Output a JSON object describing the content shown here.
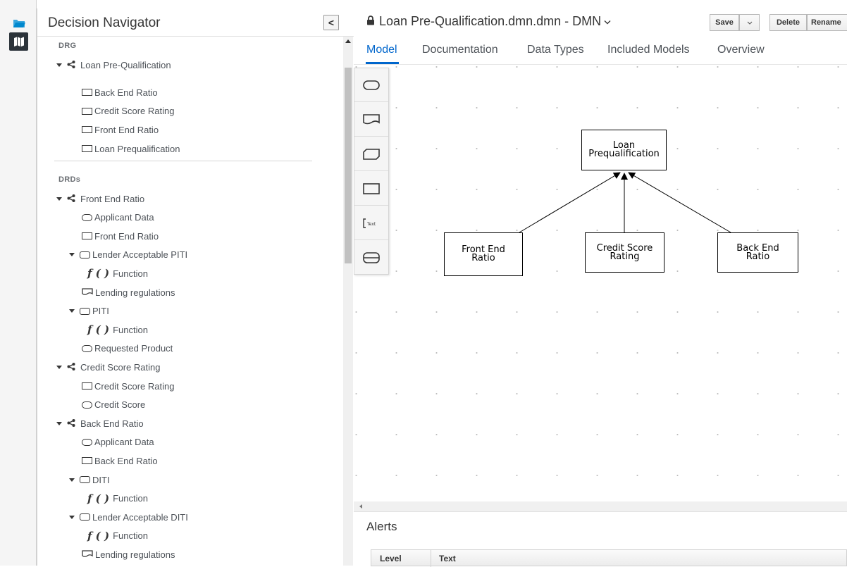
{
  "rail": {
    "items": [
      {
        "icon": "folder-icon"
      },
      {
        "icon": "map-icon"
      }
    ]
  },
  "navigator": {
    "title": "Decision Navigator",
    "collapse_glyph": "<",
    "drg": {
      "heading": "DRG",
      "root": "Loan Pre-Qualification",
      "items": [
        "Back End Ratio",
        "Credit Score Rating",
        "Front End Ratio",
        "Loan Prequalification"
      ]
    },
    "drds": {
      "heading": "DRDs",
      "rows": [
        {
          "label": "Front End Ratio",
          "kind": "diagram",
          "indent": 0
        },
        {
          "label": "Applicant Data",
          "kind": "input",
          "indent": 1
        },
        {
          "label": "Front End Ratio",
          "kind": "decision",
          "indent": 1
        },
        {
          "label": "Lender Acceptable PITI",
          "kind": "bkm",
          "indent": 1,
          "expanded": true
        },
        {
          "label": "Function",
          "kind": "function",
          "indent": 2
        },
        {
          "label": "Lending regulations",
          "kind": "knowledge",
          "indent": 1
        },
        {
          "label": "PITI",
          "kind": "bkm",
          "indent": 1,
          "expanded": true
        },
        {
          "label": "Function",
          "kind": "function",
          "indent": 2
        },
        {
          "label": "Requested Product",
          "kind": "input",
          "indent": 1
        },
        {
          "label": "Credit Score Rating",
          "kind": "diagram",
          "indent": 0
        },
        {
          "label": "Credit Score Rating",
          "kind": "decision",
          "indent": 1
        },
        {
          "label": "Credit Score",
          "kind": "input",
          "indent": 1
        },
        {
          "label": "Back End Ratio",
          "kind": "diagram",
          "indent": 0
        },
        {
          "label": "Applicant Data",
          "kind": "input",
          "indent": 1
        },
        {
          "label": "Back End Ratio",
          "kind": "decision",
          "indent": 1
        },
        {
          "label": "DITI",
          "kind": "bkm",
          "indent": 1,
          "expanded": true
        },
        {
          "label": "Function",
          "kind": "function",
          "indent": 2
        },
        {
          "label": "Lender Acceptable DITI",
          "kind": "bkm",
          "indent": 1,
          "expanded": true
        },
        {
          "label": "Function",
          "kind": "function",
          "indent": 2
        },
        {
          "label": "Lending regulations",
          "kind": "knowledge",
          "indent": 1
        }
      ],
      "function_glyph": "f ( )"
    }
  },
  "editor": {
    "title": "Loan Pre-Qualification.dmn.dmn - DMN",
    "buttons": {
      "save": "Save",
      "delete": "Delete",
      "rename": "Rename"
    },
    "tabs": [
      "Model",
      "Documentation",
      "Data Types",
      "Included Models",
      "Overview"
    ],
    "active_tab": "Model",
    "nodes": {
      "loan_prequal": [
        "Loan",
        "Prequalification"
      ],
      "front_end": [
        "Front End",
        "Ratio"
      ],
      "credit_score": [
        "Credit Score",
        "Rating"
      ],
      "back_end": [
        "Back End",
        "Ratio"
      ]
    },
    "palette": [
      "input-data-tool-icon",
      "knowledge-source-tool-icon",
      "bkm-tool-icon",
      "decision-tool-icon",
      "text-annotation-tool-icon",
      "decision-service-tool-icon"
    ],
    "alerts": {
      "title": "Alerts",
      "columns": [
        "Level",
        "Text"
      ]
    }
  }
}
